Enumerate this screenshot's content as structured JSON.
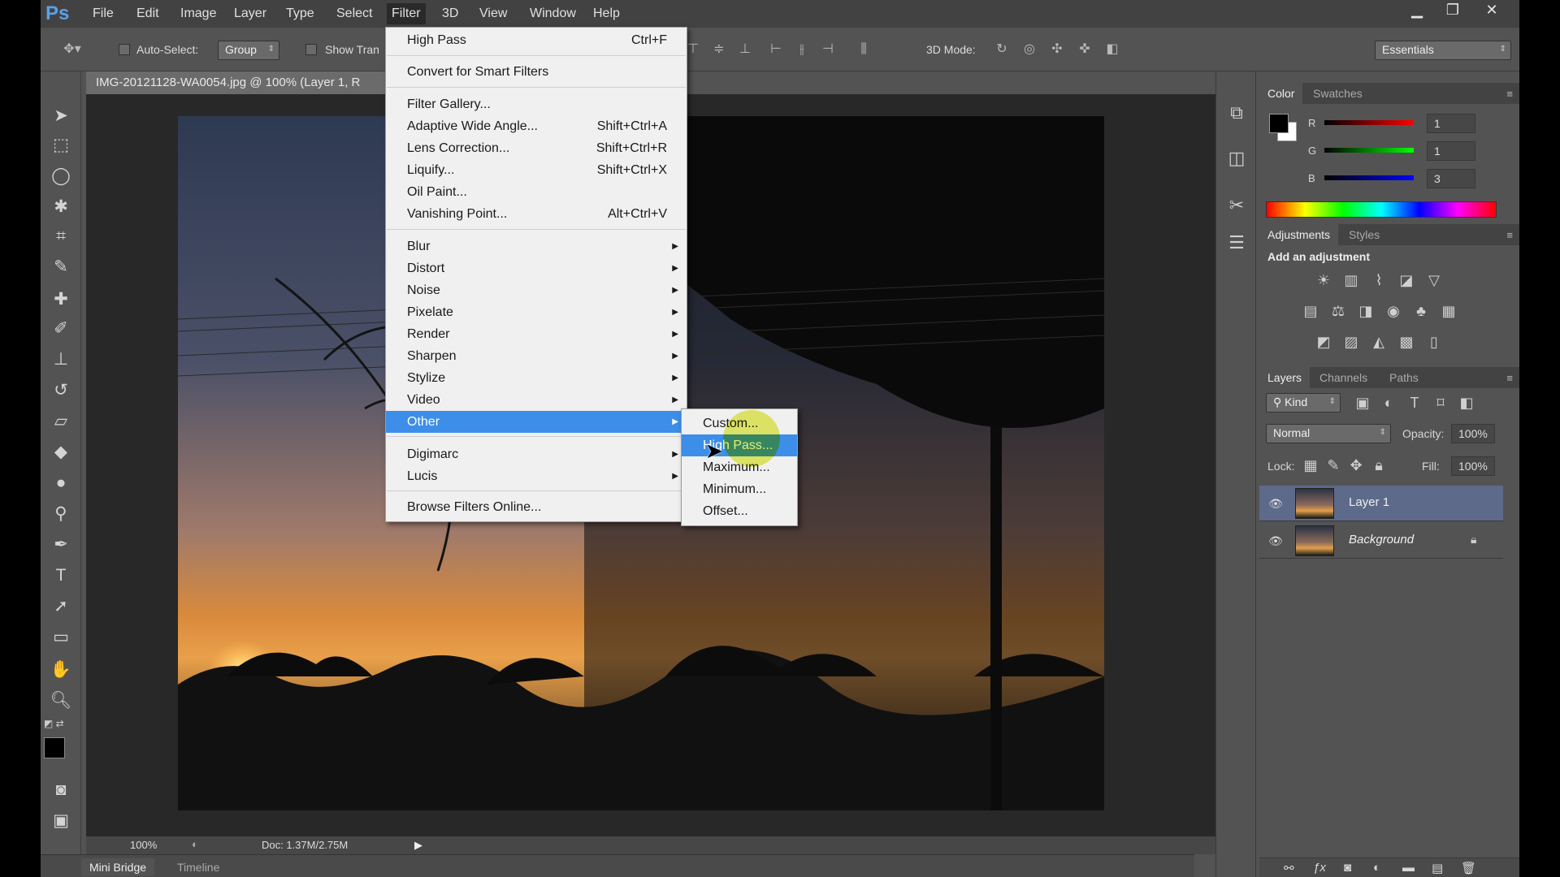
{
  "app": {
    "logo": "Ps",
    "menu": [
      "File",
      "Edit",
      "Image",
      "Layer",
      "Type",
      "Select",
      "Filter",
      "3D",
      "View",
      "Window",
      "Help"
    ],
    "window_controls": {
      "minimize": "▁",
      "restore": "❐",
      "close": "✕"
    }
  },
  "options": {
    "auto_select_label": "Auto-Select:",
    "auto_select_value": "Group",
    "show_transform_label": "Show Tran",
    "mode_3d_label": "3D Mode:",
    "workspace": "Essentials"
  },
  "document": {
    "tab_title": "IMG-20121128-WA0054.jpg @ 100% (Layer 1, R",
    "zoom": "100%",
    "doc_size": "Doc: 1.37M/2.75M"
  },
  "bottom_tabs": [
    "Mini Bridge",
    "Timeline"
  ],
  "filter_menu": {
    "items": [
      {
        "label": "High Pass",
        "shortcut": "Ctrl+F"
      },
      {
        "sep": true
      },
      {
        "label": "Convert for Smart Filters",
        "shortcut": ""
      },
      {
        "sep": true
      },
      {
        "label": "Filter Gallery...",
        "shortcut": ""
      },
      {
        "label": "Adaptive Wide Angle...",
        "shortcut": "Shift+Ctrl+A"
      },
      {
        "label": "Lens Correction...",
        "shortcut": "Shift+Ctrl+R"
      },
      {
        "label": "Liquify...",
        "shortcut": "Shift+Ctrl+X"
      },
      {
        "label": "Oil Paint...",
        "shortcut": ""
      },
      {
        "label": "Vanishing Point...",
        "shortcut": "Alt+Ctrl+V"
      },
      {
        "sep": true
      },
      {
        "label": "Blur",
        "sub": true
      },
      {
        "label": "Distort",
        "sub": true
      },
      {
        "label": "Noise",
        "sub": true
      },
      {
        "label": "Pixelate",
        "sub": true
      },
      {
        "label": "Render",
        "sub": true
      },
      {
        "label": "Sharpen",
        "sub": true
      },
      {
        "label": "Stylize",
        "sub": true
      },
      {
        "label": "Video",
        "sub": true
      },
      {
        "label": "Other",
        "sub": true,
        "highlight": true
      },
      {
        "sep": true
      },
      {
        "label": "Digimarc",
        "sub": true
      },
      {
        "label": "Lucis",
        "sub": true
      },
      {
        "sep": true
      },
      {
        "label": "Browse Filters Online...",
        "shortcut": ""
      }
    ]
  },
  "other_submenu": {
    "items": [
      {
        "label": "Custom..."
      },
      {
        "label": "High Pass...",
        "highlight": true
      },
      {
        "label": "Maximum..."
      },
      {
        "label": "Minimum..."
      },
      {
        "label": "Offset..."
      }
    ]
  },
  "color_panel": {
    "tabs": [
      "Color",
      "Swatches"
    ],
    "channels": [
      {
        "name": "R",
        "value": "1"
      },
      {
        "name": "G",
        "value": "1"
      },
      {
        "name": "B",
        "value": "3"
      }
    ]
  },
  "adjustments_panel": {
    "tabs": [
      "Adjustments",
      "Styles"
    ],
    "heading": "Add an adjustment"
  },
  "layers_panel": {
    "tabs": [
      "Layers",
      "Channels",
      "Paths"
    ],
    "kind_filter": "Kind",
    "blend_mode": "Normal",
    "opacity_label": "Opacity:",
    "opacity": "100%",
    "lock_label": "Lock:",
    "fill_label": "Fill:",
    "fill": "100%",
    "layers": [
      {
        "name": "Layer 1",
        "selected": true
      },
      {
        "name": "Background",
        "selected": false,
        "locked": true
      }
    ]
  },
  "colors": {
    "menu_highlight": "#3d8ee8",
    "cursor_highlight": "#dce614",
    "panel_bg": "#535353"
  }
}
